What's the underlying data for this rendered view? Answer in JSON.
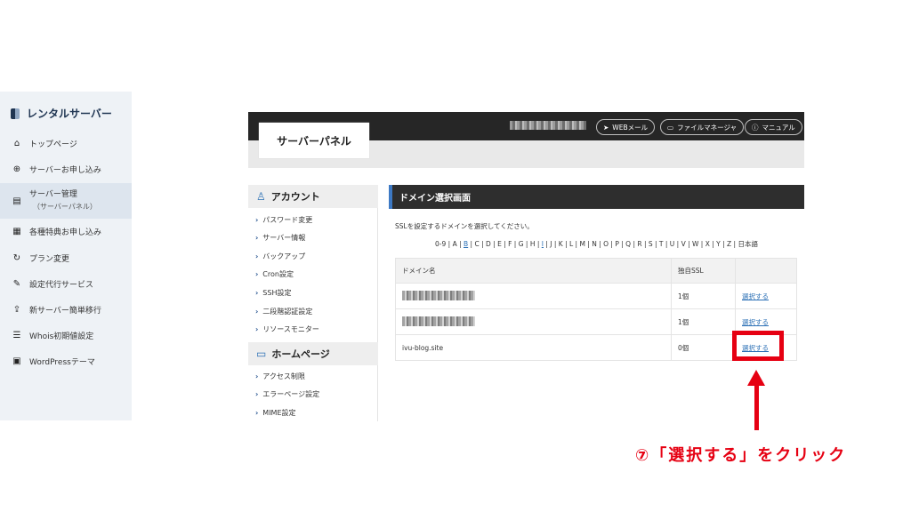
{
  "sidebar": {
    "brand": "レンタルサーバー",
    "items": [
      {
        "label": "トップページ",
        "icon": "home-icon"
      },
      {
        "label": "サーバーお申し込み",
        "icon": "plus-circle-icon"
      },
      {
        "label": "サーバー管理",
        "sub": "（サーバーパネル）",
        "icon": "server-icon"
      },
      {
        "label": "各種特典お申し込み",
        "icon": "gift-icon"
      },
      {
        "label": "プラン変更",
        "icon": "refresh-icon"
      },
      {
        "label": "設定代行サービス",
        "icon": "wrench-icon"
      },
      {
        "label": "新サーバー簡単移行",
        "icon": "upload-icon"
      },
      {
        "label": "Whois初期値設定",
        "icon": "document-icon"
      },
      {
        "label": "WordPressテーマ",
        "icon": "window-icon"
      }
    ]
  },
  "panel": {
    "title": "サーバーパネル",
    "buttons": {
      "webmail": "WEBメール",
      "filemanager": "ファイルマネージャ",
      "manual": "マニュアル"
    },
    "account_section": {
      "title": "アカウント",
      "links": [
        "パスワード変更",
        "サーバー情報",
        "バックアップ",
        "Cron設定",
        "SSH設定",
        "二段階認証設定",
        "リソースモニター"
      ]
    },
    "homepage_section": {
      "title": "ホームページ",
      "links": [
        "アクセス制限",
        "エラーページ設定",
        "MIME設定"
      ]
    },
    "content": {
      "heading": "ドメイン選択画面",
      "instruction": "SSLを設定するドメインを選択してください。",
      "alpha_pre": "0-9 | A | ",
      "alpha_b": "B",
      "alpha_mid": " | C | D | E | F | G | H | ",
      "alpha_i": "I",
      "alpha_post": " | J | K | L | M | N | O | P | Q | R | S | T | U | V | W | X | Y | Z | 日本語",
      "table": {
        "headers": [
          "ドメイン名",
          "独自SSL",
          ""
        ],
        "rows": [
          {
            "domain": "",
            "ssl": "1個",
            "action": "選択する"
          },
          {
            "domain": "",
            "ssl": "1個",
            "action": "選択する"
          },
          {
            "domain": "ivu-blog.site",
            "ssl": "0個",
            "action": "選択する"
          }
        ]
      }
    }
  },
  "annotation": {
    "text": "⑦「選択する」をクリック",
    "color": "#e60012"
  }
}
